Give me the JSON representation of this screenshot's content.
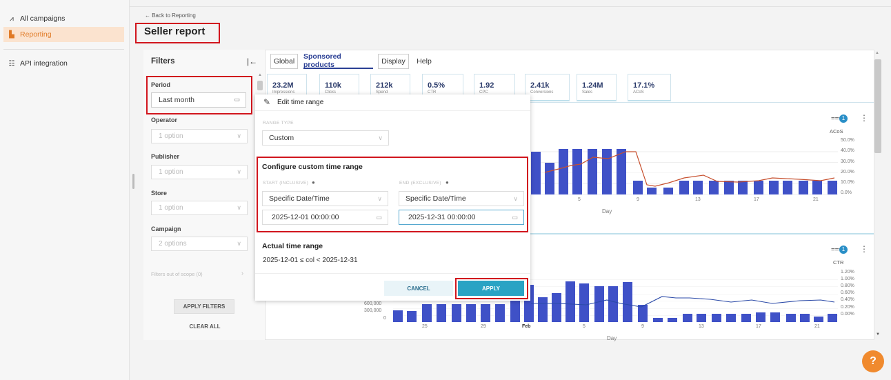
{
  "sidebar": {
    "items": [
      {
        "label": "All campaigns",
        "icon": "trend-icon"
      },
      {
        "label": "Reporting",
        "icon": "file-icon"
      },
      {
        "label": "API integration",
        "icon": "api-icon"
      }
    ]
  },
  "header": {
    "back": "← Back to Reporting",
    "title": "Seller report"
  },
  "filters": {
    "title": "Filters",
    "collapse": "|←",
    "period_label": "Period",
    "period_value": "Last month",
    "operator_label": "Operator",
    "operator_value": "1 option",
    "publisher_label": "Publisher",
    "publisher_value": "1 option",
    "store_label": "Store",
    "store_value": "1 option",
    "campaign_label": "Campaign",
    "campaign_value": "2 options",
    "out_of_scope": "Filters out of scope (0)",
    "apply": "APPLY FILTERS",
    "clear": "CLEAR ALL"
  },
  "tabs": [
    "Global",
    "Sponsored products",
    "Display",
    "Help"
  ],
  "kpis": [
    {
      "value": "23.2M",
      "label": "Impressions"
    },
    {
      "value": "110k",
      "label": "Clicks"
    },
    {
      "value": "212k",
      "label": "Spend"
    },
    {
      "value": "0.5%",
      "label": "CTR"
    },
    {
      "value": "1.92",
      "label": "CPC"
    },
    {
      "value": "2.41k",
      "label": "Conversions"
    },
    {
      "value": "1.24M",
      "label": "Sales"
    },
    {
      "value": "17.1%",
      "label": "ACoS"
    }
  ],
  "popup": {
    "title": "Edit time range",
    "range_type_label": "RANGE TYPE",
    "range_type_value": "Custom",
    "configure_title": "Configure custom time range",
    "start_label": "START (INCLUSIVE)",
    "end_label": "END (EXCLUSIVE)",
    "start_type": "Specific Date/Time",
    "end_type": "Specific Date/Time",
    "start_value": "2025-12-01 00:00:00",
    "end_value": "2025-12-31 00:00:00",
    "actual_title": "Actual time range",
    "actual_value": "2025-12-01 ≤ col < 2025-12-31",
    "cancel": "CANCEL",
    "apply": "APPLY"
  },
  "chart1": {
    "filter_count": "1",
    "right_title": "ACoS",
    "right_ticks": [
      "50.0%",
      "40.0%",
      "30.0%",
      "20.0%",
      "10.0%",
      "0.0%"
    ],
    "x_ticks": [
      "5",
      "9",
      "13",
      "17",
      "21"
    ],
    "xlabel": "Day"
  },
  "chart2": {
    "filter_count": "1",
    "right_title": "CTR",
    "right_ticks": [
      "1.20%",
      "1.00%",
      "0.80%",
      "0.60%",
      "0.40%",
      "0.20%",
      "0.00%"
    ],
    "left_ticks": [
      "600,000",
      "300,000",
      "0"
    ],
    "x_ticks": [
      "25",
      "29",
      "Feb",
      "5",
      "9",
      "13",
      "17",
      "21"
    ],
    "xlabel": "Day"
  }
}
